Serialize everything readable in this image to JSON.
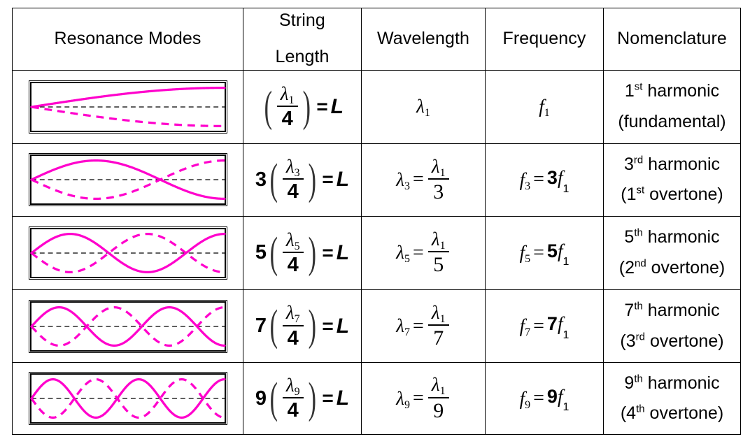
{
  "table": {
    "headers": [
      {
        "label": "Resonance Modes",
        "name": "header-resonance-modes"
      },
      {
        "label_line1": "String",
        "label_line2": "Length",
        "name": "header-string-length"
      },
      {
        "label": "Wavelength",
        "name": "header-wavelength"
      },
      {
        "label": "Frequency",
        "name": "header-frequency"
      },
      {
        "label": "Nomenclature",
        "name": "header-nomenclature"
      }
    ],
    "rows": [
      {
        "harmonic_number": 1,
        "quarter_wavelengths": 1,
        "diagram": {
          "type": "standing-wave-closed-open-pipe",
          "quarter_waves": 1,
          "node_positions_fraction": [
            0
          ],
          "antinode_positions_fraction": [
            1
          ]
        },
        "string_length": {
          "coefficient": "",
          "numerator": "λ",
          "numerator_sub": "1",
          "denominator": "4",
          "equals": "=",
          "result": "L"
        },
        "wavelength": {
          "lhs": "λ",
          "lhs_sub": "1",
          "has_fraction": false,
          "rhs_num": "",
          "rhs_num_sub": "",
          "rhs_den": ""
        },
        "frequency": {
          "lhs": "f",
          "lhs_sub": "1",
          "has_rhs": false,
          "multiplier": "",
          "rhs_sym": "",
          "rhs_sub": ""
        },
        "nomenclature": {
          "line1_number": "1",
          "line1_suffix": "st",
          "line1_word": "harmonic",
          "line2": "(fundamental)",
          "line2_number": "",
          "line2_suffix": "",
          "line2_word": ""
        }
      },
      {
        "harmonic_number": 3,
        "quarter_wavelengths": 3,
        "diagram": {
          "type": "standing-wave-closed-open-pipe",
          "quarter_waves": 3,
          "node_positions_fraction": [
            0,
            0.6667
          ],
          "antinode_positions_fraction": [
            0.3333,
            1
          ]
        },
        "string_length": {
          "coefficient": "3",
          "numerator": "λ",
          "numerator_sub": "3",
          "denominator": "4",
          "equals": "=",
          "result": "L"
        },
        "wavelength": {
          "lhs": "λ",
          "lhs_sub": "3",
          "has_fraction": true,
          "rhs_num": "λ",
          "rhs_num_sub": "1",
          "rhs_den": "3"
        },
        "frequency": {
          "lhs": "f",
          "lhs_sub": "3",
          "has_rhs": true,
          "multiplier": "3",
          "rhs_sym": "f",
          "rhs_sub": "1"
        },
        "nomenclature": {
          "line1_number": "3",
          "line1_suffix": "rd",
          "line1_word": "harmonic",
          "line2": "",
          "line2_number": "1",
          "line2_suffix": "st",
          "line2_word": "overtone"
        }
      },
      {
        "harmonic_number": 5,
        "quarter_wavelengths": 5,
        "diagram": {
          "type": "standing-wave-closed-open-pipe",
          "quarter_waves": 5,
          "node_positions_fraction": [
            0,
            0.4,
            0.8
          ],
          "antinode_positions_fraction": [
            0.2,
            0.6,
            1
          ]
        },
        "string_length": {
          "coefficient": "5",
          "numerator": "λ",
          "numerator_sub": "5",
          "denominator": "4",
          "equals": "=",
          "result": "L"
        },
        "wavelength": {
          "lhs": "λ",
          "lhs_sub": "5",
          "has_fraction": true,
          "rhs_num": "λ",
          "rhs_num_sub": "1",
          "rhs_den": "5"
        },
        "frequency": {
          "lhs": "f",
          "lhs_sub": "5",
          "has_rhs": true,
          "multiplier": "5",
          "rhs_sym": "f",
          "rhs_sub": "1"
        },
        "nomenclature": {
          "line1_number": "5",
          "line1_suffix": "th",
          "line1_word": "harmonic",
          "line2": "",
          "line2_number": "2",
          "line2_suffix": "nd",
          "line2_word": "overtone"
        }
      },
      {
        "harmonic_number": 7,
        "quarter_wavelengths": 7,
        "diagram": {
          "type": "standing-wave-closed-open-pipe",
          "quarter_waves": 7,
          "node_positions_fraction": [
            0,
            0.2857,
            0.5714,
            0.8571
          ],
          "antinode_positions_fraction": [
            0.1429,
            0.4286,
            0.7143,
            1
          ]
        },
        "string_length": {
          "coefficient": "7",
          "numerator": "λ",
          "numerator_sub": "7",
          "denominator": "4",
          "equals": "=",
          "result": "L"
        },
        "wavelength": {
          "lhs": "λ",
          "lhs_sub": "7",
          "has_fraction": true,
          "rhs_num": "λ",
          "rhs_num_sub": "1",
          "rhs_den": "7"
        },
        "frequency": {
          "lhs": "f",
          "lhs_sub": "7",
          "has_rhs": true,
          "multiplier": "7",
          "rhs_sym": "f",
          "rhs_sub": "1"
        },
        "nomenclature": {
          "line1_number": "7",
          "line1_suffix": "th",
          "line1_word": "harmonic",
          "line2": "",
          "line2_number": "3",
          "line2_suffix": "rd",
          "line2_word": "overtone"
        }
      },
      {
        "harmonic_number": 9,
        "quarter_wavelengths": 9,
        "diagram": {
          "type": "standing-wave-closed-open-pipe",
          "quarter_waves": 9,
          "node_positions_fraction": [
            0,
            0.2222,
            0.4444,
            0.6667,
            0.8889
          ],
          "antinode_positions_fraction": [
            0.1111,
            0.3333,
            0.5556,
            0.7778,
            1
          ]
        },
        "string_length": {
          "coefficient": "9",
          "numerator": "λ",
          "numerator_sub": "9",
          "denominator": "4",
          "equals": "=",
          "result": "L"
        },
        "wavelength": {
          "lhs": "λ",
          "lhs_sub": "9",
          "has_fraction": true,
          "rhs_num": "λ",
          "rhs_num_sub": "1",
          "rhs_den": "9"
        },
        "frequency": {
          "lhs": "f",
          "lhs_sub": "9",
          "has_rhs": true,
          "multiplier": "9",
          "rhs_sym": "f",
          "rhs_sub": "1"
        },
        "nomenclature": {
          "line1_number": "9",
          "line1_suffix": "th",
          "line1_word": "harmonic",
          "line2": "",
          "line2_number": "4",
          "line2_suffix": "th",
          "line2_word": "overtone"
        }
      }
    ]
  },
  "colors": {
    "wave": "#ff00cc",
    "axis": "#000000",
    "border": "#000000",
    "background": "#ffffff"
  }
}
